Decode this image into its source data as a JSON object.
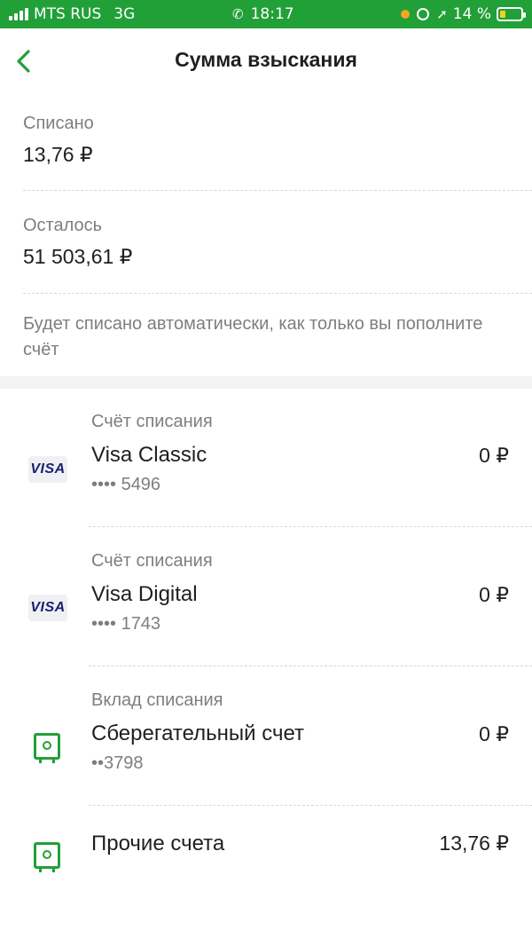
{
  "status": {
    "carrier": "MTS RUS",
    "network": "3G",
    "time": "18:17",
    "battery": "14 %",
    "battery_level": 0.14,
    "colors": {
      "bar": "#21a038",
      "dot": "#f5a623"
    }
  },
  "nav": {
    "back_icon": "chevron-left-icon",
    "title": "Сумма взыскания"
  },
  "summary": {
    "charged_label": "Списано",
    "charged_value": "13,76 ₽",
    "remaining_label": "Осталось",
    "remaining_value": "51 503,61 ₽",
    "note": "Будет списано автоматически, как только вы пополните счёт"
  },
  "accounts": [
    {
      "label": "Счёт списания",
      "name": "Visa Classic",
      "number": "•••• 5496",
      "amount": "0 ₽",
      "icon": "visa-icon",
      "icon_text": "VISA"
    },
    {
      "label": "Счёт списания",
      "name": "Visa Digital",
      "number": "•••• 1743",
      "amount": "0 ₽",
      "icon": "visa-icon",
      "icon_text": "VISA"
    },
    {
      "label": "Вклад списания",
      "name": "Сберегательный счет",
      "number": "••3798",
      "amount": "0 ₽",
      "icon": "safe-icon"
    },
    {
      "label": "",
      "name": "Прочие счета",
      "number": "",
      "amount": "13,76 ₽",
      "icon": "safe-icon"
    }
  ],
  "accent_color": "#21a038"
}
